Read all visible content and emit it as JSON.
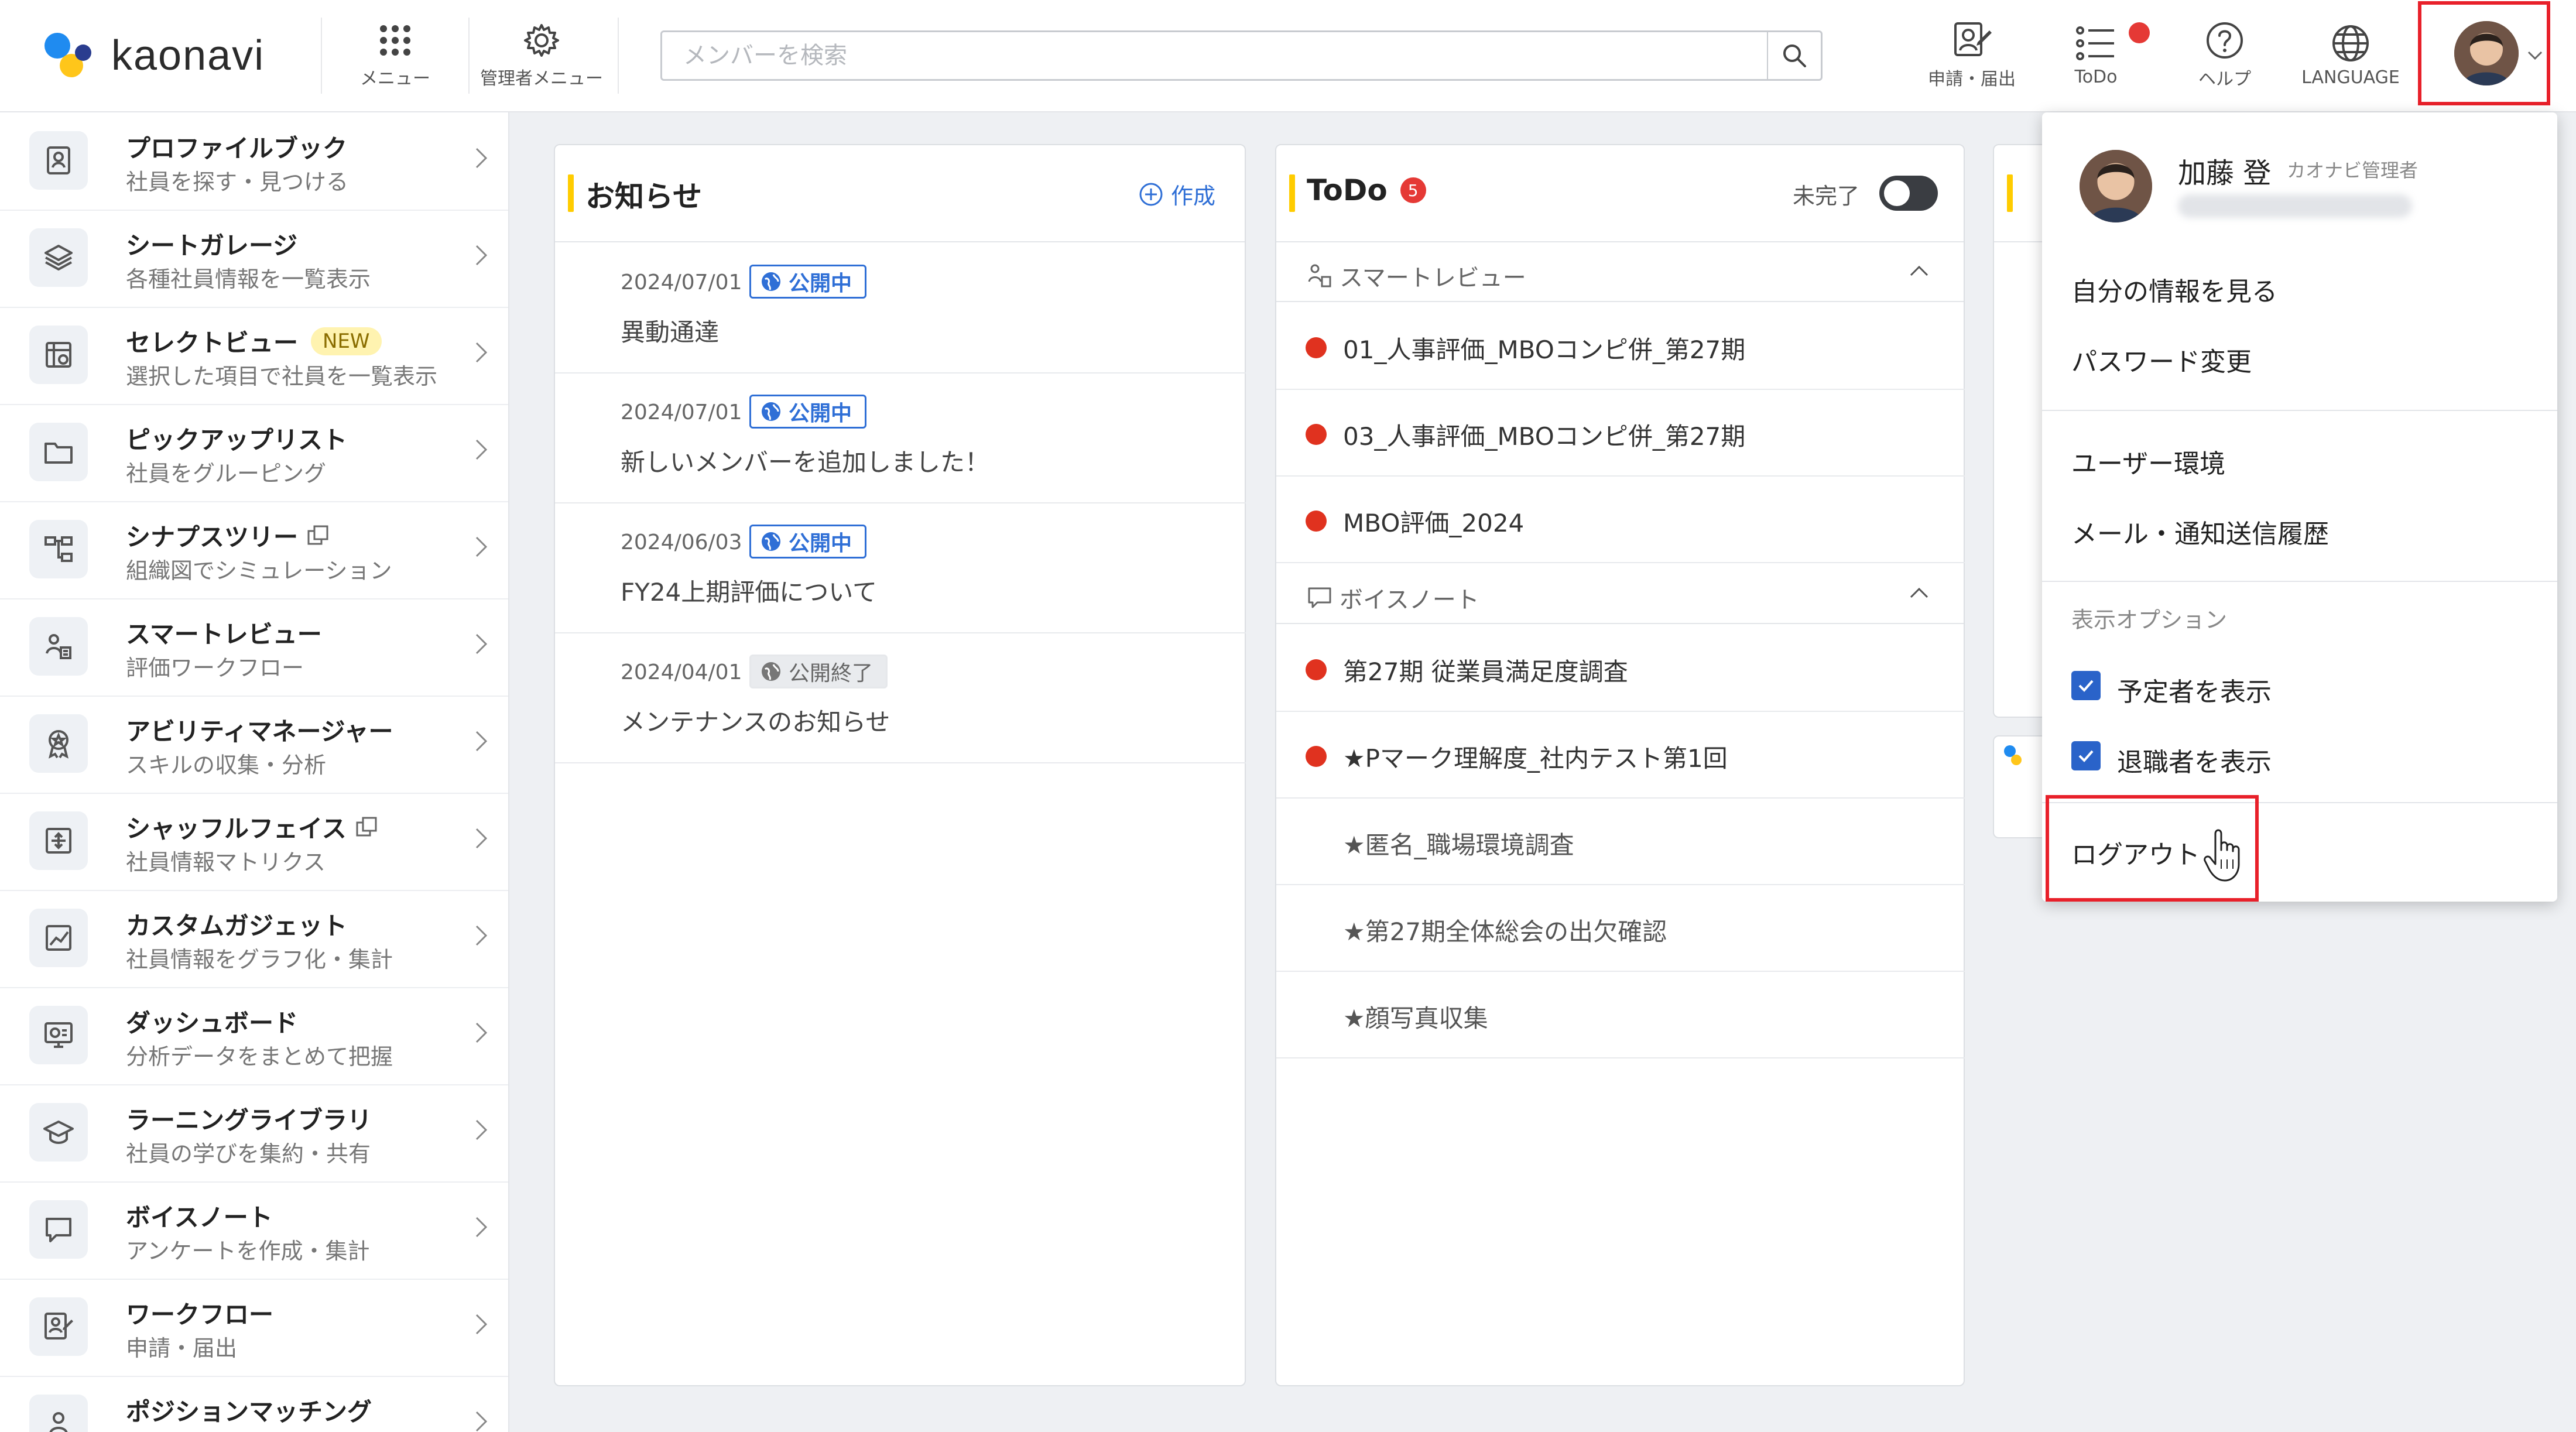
{
  "header": {
    "logo_text": "kaonavi",
    "menu_label": "メニュー",
    "admin_menu_label": "管理者メニュー",
    "search_placeholder": "メンバーを検索",
    "workflow_label": "申請・届出",
    "todo_label": "ToDo",
    "help_label": "ヘルプ",
    "language_label": "LANGUAGE"
  },
  "sidebar": {
    "items": [
      {
        "title": "プロファイルブック",
        "subtitle": "社員を探す・見つける",
        "icon": "profile-book-icon"
      },
      {
        "title": "シートガレージ",
        "subtitle": "各種社員情報を一覧表示",
        "icon": "layers-icon"
      },
      {
        "title": "セレクトビュー",
        "subtitle": "選択した項目で社員を一覧表示",
        "badge": "NEW",
        "icon": "select-view-icon"
      },
      {
        "title": "ピックアップリスト",
        "subtitle": "社員をグルーピング",
        "icon": "folder-icon"
      },
      {
        "title": "シナプスツリー",
        "subtitle": "組織図でシミュレーション",
        "external": true,
        "icon": "org-tree-icon"
      },
      {
        "title": "スマートレビュー",
        "subtitle": "評価ワークフロー",
        "icon": "review-icon"
      },
      {
        "title": "アビリティマネージャー",
        "subtitle": "スキルの収集・分析",
        "icon": "award-icon"
      },
      {
        "title": "シャッフルフェイス",
        "subtitle": "社員情報マトリクス",
        "external": true,
        "icon": "matrix-icon"
      },
      {
        "title": "カスタムガジェット",
        "subtitle": "社員情報をグラフ化・集計",
        "icon": "chart-icon"
      },
      {
        "title": "ダッシュボード",
        "subtitle": "分析データをまとめて把握",
        "icon": "dashboard-icon"
      },
      {
        "title": "ラーニングライブラリ",
        "subtitle": "社員の学びを集約・共有",
        "icon": "graduation-cap-icon"
      },
      {
        "title": "ボイスノート",
        "subtitle": "アンケートを作成・集計",
        "icon": "speech-bubble-icon"
      },
      {
        "title": "ワークフロー",
        "subtitle": "申請・届出",
        "icon": "workflow-icon"
      },
      {
        "title": "ポジションマッチング",
        "subtitle": "",
        "icon": "position-icon"
      }
    ]
  },
  "news": {
    "title": "お知らせ",
    "create_label": "作成",
    "items": [
      {
        "date": "2024/07/01",
        "status": "公開中",
        "status_type": "published",
        "text": "異動通達"
      },
      {
        "date": "2024/07/01",
        "status": "公開中",
        "status_type": "published",
        "text": "新しいメンバーを追加しました！"
      },
      {
        "date": "2024/06/03",
        "status": "公開中",
        "status_type": "published",
        "text": "FY24上期評価について"
      },
      {
        "date": "2024/04/01",
        "status": "公開終了",
        "status_type": "ended",
        "text": "メンテナンスのお知らせ"
      }
    ]
  },
  "todo": {
    "title": "ToDo",
    "count": "5",
    "incomplete_label": "未完了",
    "sections": [
      {
        "title": "スマートレビュー",
        "items": [
          {
            "text": "01_人事評価_MBOコンピ併_第27期",
            "unread": true
          },
          {
            "text": "03_人事評価_MBOコンピ併_第27期",
            "unread": true
          },
          {
            "text": "MBO評価_2024",
            "unread": true
          }
        ]
      },
      {
        "title": "ボイスノート",
        "items": [
          {
            "text": "第27期 従業員満足度調査",
            "unread": true
          },
          {
            "text": "★Pマーク理解度_社内テスト第1回",
            "unread": true
          },
          {
            "text": "★匿名_職場環境調査",
            "unread": false
          },
          {
            "text": "★第27期全体総会の出欠確認",
            "unread": false
          },
          {
            "text": "★顔写真収集",
            "unread": false
          }
        ]
      }
    ]
  },
  "user_menu": {
    "name": "加藤 登",
    "role": "カオナビ管理者",
    "view_profile": "自分の情報を見る",
    "change_password": "パスワード変更",
    "user_settings": "ユーザー環境",
    "mail_history": "メール・通知送信履歴",
    "display_options_label": "表示オプション",
    "show_scheduled": "予定者を表示",
    "show_retired": "退職者を表示",
    "show_scheduled_checked": true,
    "show_retired_checked": true,
    "logout": "ログアウト"
  },
  "colors": {
    "accent_yellow": "#ffcc00",
    "highlight_red": "#e8202a",
    "notification_red": "#e53935",
    "link_blue": "#2f6fd6"
  }
}
